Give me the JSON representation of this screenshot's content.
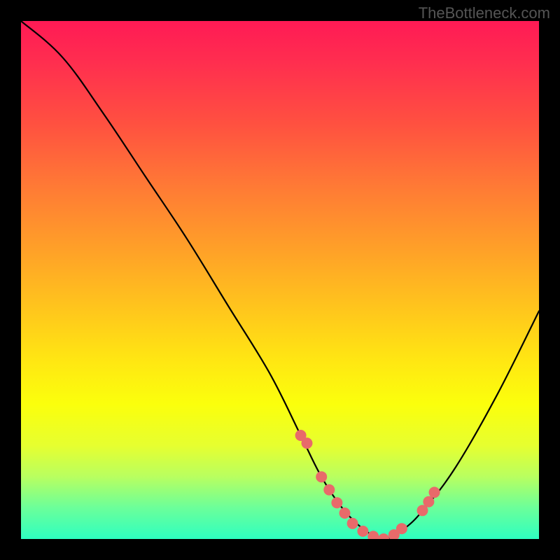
{
  "attribution": "TheBottleneck.com",
  "chart_data": {
    "type": "line",
    "title": "",
    "xlabel": "",
    "ylabel": "",
    "xlim": [
      0,
      100
    ],
    "ylim": [
      0,
      100
    ],
    "curve": {
      "x": [
        0,
        8,
        16,
        24,
        32,
        40,
        48,
        54,
        58,
        62,
        66,
        70,
        74,
        78,
        84,
        92,
        100
      ],
      "y": [
        100,
        93,
        82,
        70,
        58,
        45,
        32,
        20,
        12,
        6,
        2,
        0,
        2,
        6,
        14,
        28,
        44
      ]
    },
    "markers": {
      "x": [
        54,
        55.2,
        58,
        59.5,
        61,
        62.5,
        64,
        66,
        68,
        70,
        72,
        73.5,
        77.5,
        78.7,
        79.8
      ],
      "y": [
        20,
        18.5,
        12,
        9.5,
        7,
        5,
        3,
        1.5,
        0.5,
        0,
        0.8,
        2,
        5.5,
        7.2,
        9
      ],
      "color": "#e86a6a",
      "radius": 8
    }
  }
}
